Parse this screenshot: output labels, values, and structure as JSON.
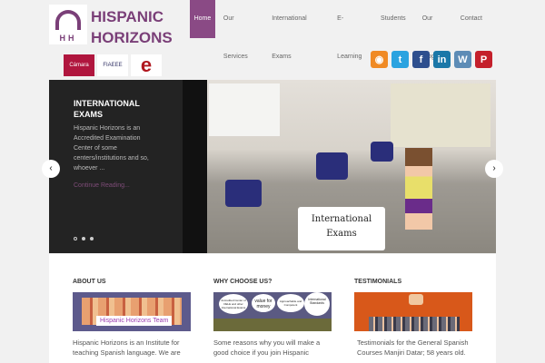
{
  "header": {
    "logo_line1": "HISPANIC",
    "logo_line2": "HORIZONS",
    "logo_initials": "HH",
    "partners": [
      "Cámara",
      "FIAEEE",
      "e"
    ],
    "nav": [
      "Home",
      "Our Services",
      "International Exams",
      "E-Learning",
      "Students",
      "Our Blog",
      "Contact Us"
    ],
    "social": [
      "rss-icon",
      "twitter-icon",
      "facebook-icon",
      "linkedin-icon",
      "wordpress-icon",
      "pinterest-icon"
    ]
  },
  "slider": {
    "title": "INTERNATIONAL EXAMS",
    "text": "Hispanic Horizons is an Accredited Examination Center of some centers/institutions and so, whoever ...",
    "more": "Continue Reading...",
    "bubble": "International Exams",
    "prev": "‹",
    "next": "›"
  },
  "sections": [
    {
      "title": "ABOUT US",
      "banner": "Hispanic Horizons Team",
      "text": "Hispanic Horizons is an Institute for teaching Spanish language. We are"
    },
    {
      "title": "WHY CHOOSE US?",
      "banner": [
        "Accredited Center of DELE and other International Exams",
        "value for money",
        "Approachable and Competent",
        "International Standards"
      ],
      "text": "Some reasons why you will make a good choice if you join Hispanic"
    },
    {
      "title": "TESTIMONIALS",
      "text": "Testimonials for the General Spanish Courses Manjiri Datar; 58 years old."
    }
  ]
}
